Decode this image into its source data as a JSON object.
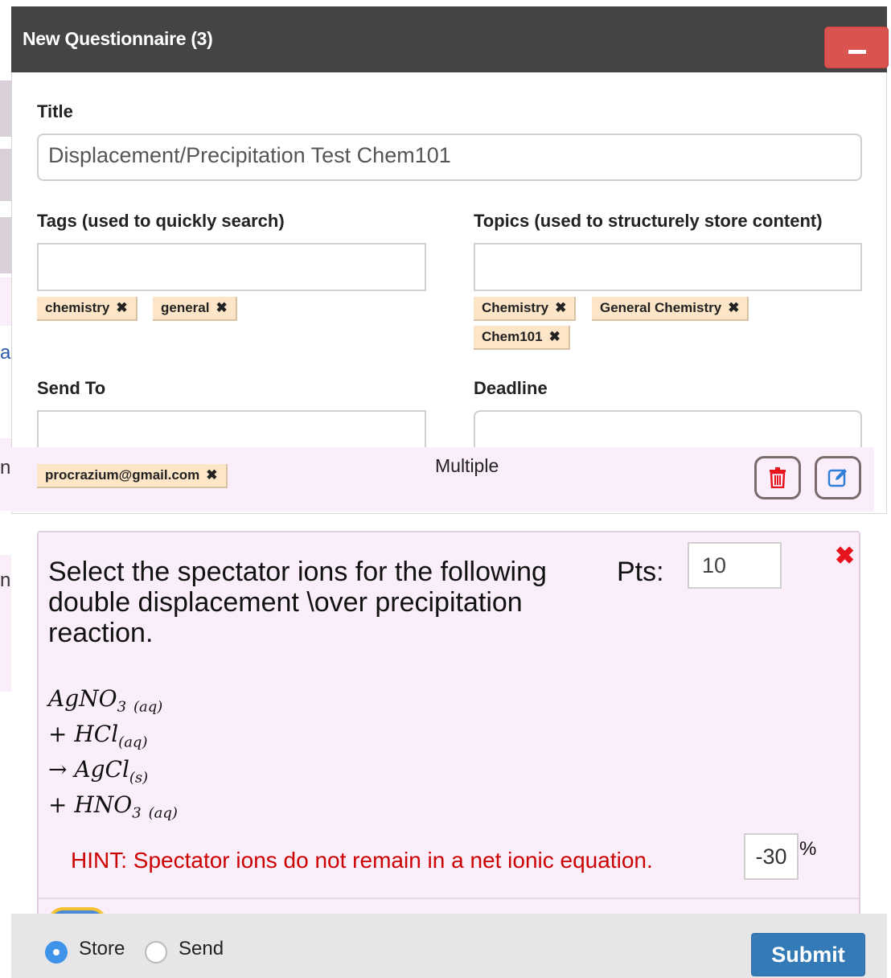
{
  "modal": {
    "title": "New Questionnaire (3)"
  },
  "form": {
    "title_label": "Title",
    "title_value": "Displacement/Precipitation Test Chem101",
    "tags_label": "Tags (used to quickly search)",
    "tags": [
      "chemistry",
      "general"
    ],
    "topics_label": "Topics (used to structurely store content)",
    "topics": [
      "Chemistry",
      "General Chemistry",
      "Chem101"
    ],
    "send_to_label": "Send To",
    "recipients": [
      "procrazium@gmail.com"
    ],
    "deadline_label": "Deadline"
  },
  "question": {
    "type_label": "Multiple",
    "text": "Select the spectator ions for the following double displacement \\over precipitation reaction.",
    "pts_label": "Pts:",
    "pts_value": "10",
    "equation": [
      {
        "op": "",
        "species": "AgNO",
        "sub": "3",
        "state": "(aq)"
      },
      {
        "op": "+",
        "species": "HCl",
        "sub": "",
        "state": "(aq)"
      },
      {
        "op": "→",
        "species": "AgCl",
        "sub": "",
        "state": "(s)"
      },
      {
        "op": "+",
        "species": "HNO",
        "sub": "3",
        "state": "(aq)"
      }
    ],
    "hint": "HINT: Spectator ions do not remain in a net ionic equation.",
    "penalty_value": "-30",
    "penalty_unit": "%"
  },
  "footer": {
    "store_label": "Store",
    "send_label": "Send",
    "selected": "Store",
    "submit_label": "Submit"
  },
  "background": {
    "peek_letters": [
      "a",
      "n.",
      "n."
    ]
  },
  "colors": {
    "header_bg": "#444444",
    "danger": "#d9534f",
    "primary": "#337ab7",
    "tag_bg": "#fde5c7",
    "card_bg": "#fbeefb",
    "hint": "#cc0000"
  }
}
